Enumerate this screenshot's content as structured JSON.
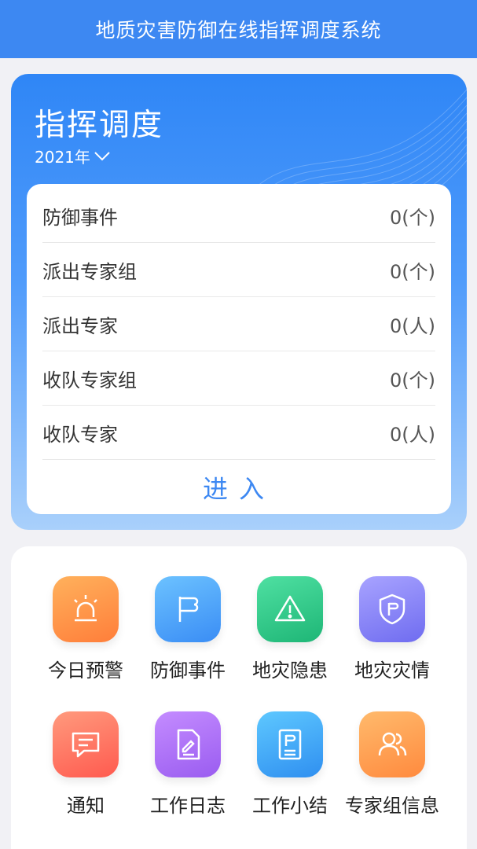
{
  "app": {
    "title": "地质灾害防御在线指挥调度系统"
  },
  "dispatch": {
    "title": "指挥调度",
    "year": "2021年",
    "rows": [
      {
        "label": "防御事件",
        "value": "0(个)"
      },
      {
        "label": "派出专家组",
        "value": "0(个)"
      },
      {
        "label": "派出专家",
        "value": "0(人)"
      },
      {
        "label": "收队专家组",
        "value": "0(个)"
      },
      {
        "label": "收队专家",
        "value": "0(人)"
      }
    ],
    "enter_label": "进入"
  },
  "menu": [
    {
      "label": "今日预警",
      "icon": "alarm-light-icon",
      "color_from": "#ffb15c",
      "color_to": "#ff7e3a"
    },
    {
      "label": "防御事件",
      "icon": "flag-icon",
      "color_from": "#6cc2ff",
      "color_to": "#3a8df5"
    },
    {
      "label": "地灾隐患",
      "icon": "warning-triangle-icon",
      "color_from": "#4fe0a2",
      "color_to": "#1eb676"
    },
    {
      "label": "地灾灾情",
      "icon": "shield-flag-icon",
      "color_from": "#a8a3ff",
      "color_to": "#6f6cf0"
    },
    {
      "label": "通知",
      "icon": "message-icon",
      "color_from": "#ff9a7d",
      "color_to": "#ff5a4f"
    },
    {
      "label": "工作日志",
      "icon": "edit-document-icon",
      "color_from": "#c48cff",
      "color_to": "#9a5cf0"
    },
    {
      "label": "工作小结",
      "icon": "summary-document-icon",
      "color_from": "#5ec8ff",
      "color_to": "#2f8ff0"
    },
    {
      "label": "专家组信息",
      "icon": "expert-group-icon",
      "color_from": "#ffba6c",
      "color_to": "#ff8a3e"
    }
  ]
}
